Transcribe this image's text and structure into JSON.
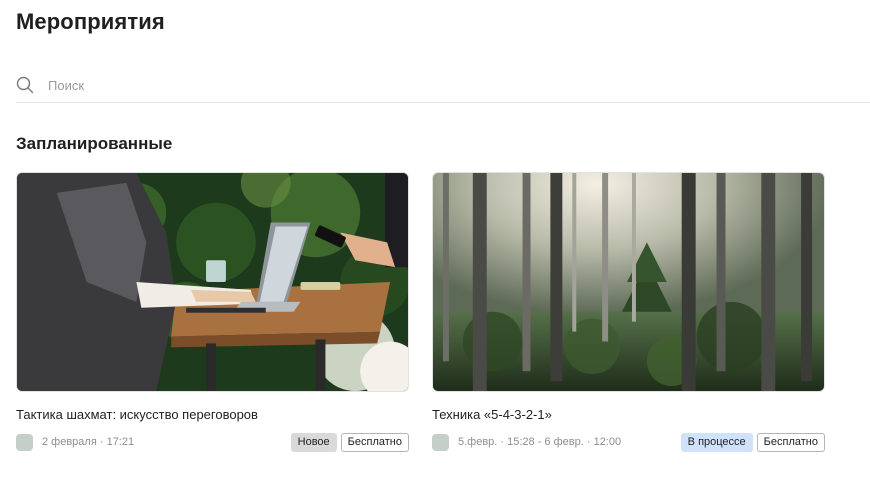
{
  "page": {
    "title": "Мероприятия"
  },
  "search": {
    "placeholder": "Поиск",
    "icon": "search-icon"
  },
  "section": {
    "title": "Запланированные"
  },
  "events": [
    {
      "title": "Тактика шахмат: искусство переговоров",
      "date": "2 февраля · 17:21",
      "badges": [
        "Новое",
        "Бесплатно"
      ],
      "image": "photo-laptop-outdoor-table"
    },
    {
      "title": "Техника «5-4-3-2-1»",
      "date": "5.февр. · 15:28 - 6 февр. · 12:00",
      "badges": [
        "В процессе",
        "Бесплатно"
      ],
      "image": "photo-misty-forest"
    }
  ],
  "colors": {
    "badge_new_bg": "#d9d9d9",
    "badge_progress_bg": "#cfe1fb",
    "avatar_bg": "#c4cfc9"
  }
}
